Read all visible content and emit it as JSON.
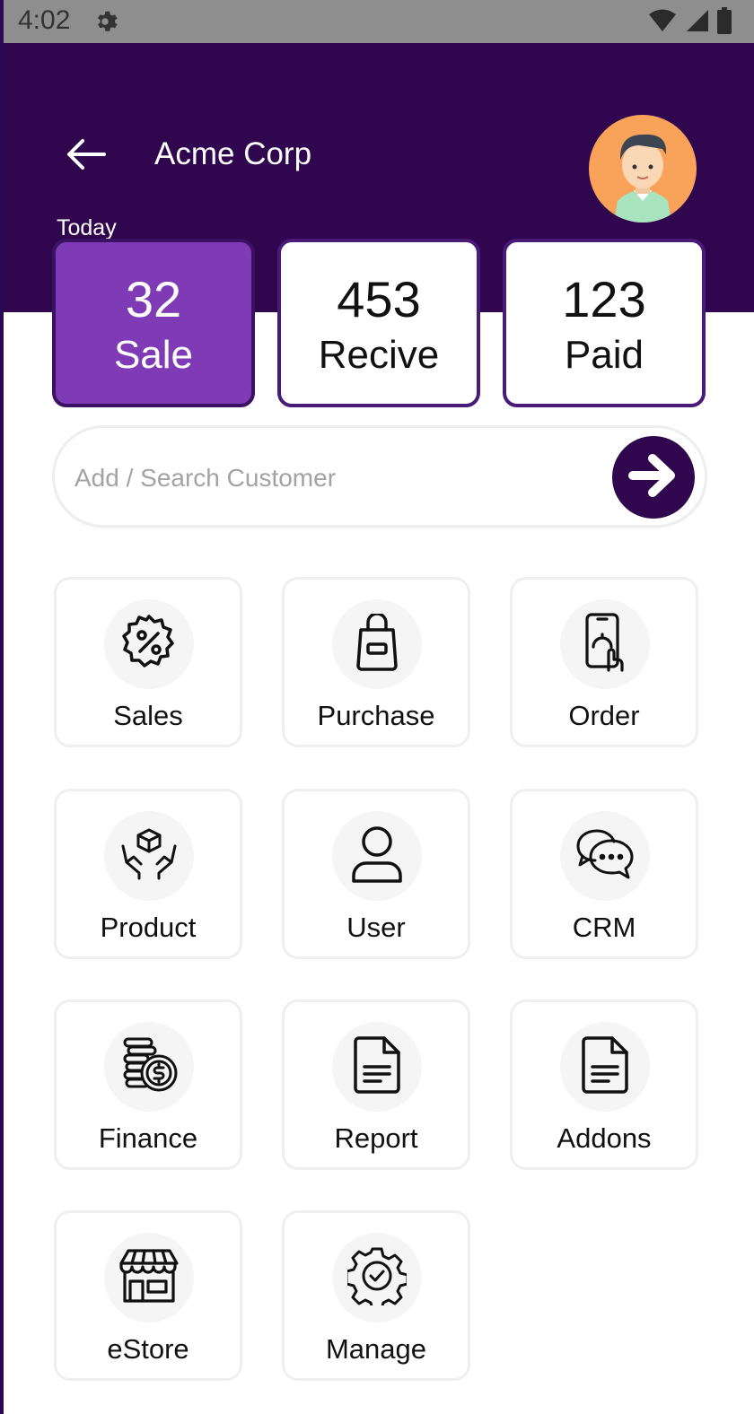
{
  "status_bar": {
    "time": "4:02"
  },
  "header": {
    "company": "Acme Corp",
    "period": "Today"
  },
  "stats": [
    {
      "value": "32",
      "label": "Sale"
    },
    {
      "value": "453",
      "label": "Recive"
    },
    {
      "value": "123",
      "label": "Paid"
    }
  ],
  "search": {
    "placeholder": "Add / Search Customer"
  },
  "tiles": [
    {
      "label": "Sales",
      "icon": "percent-badge-icon"
    },
    {
      "label": "Purchase",
      "icon": "shopping-bag-icon"
    },
    {
      "label": "Order",
      "icon": "mobile-order-icon"
    },
    {
      "label": "Product",
      "icon": "product-hands-icon"
    },
    {
      "label": "User",
      "icon": "user-icon"
    },
    {
      "label": "CRM",
      "icon": "chat-bubbles-icon"
    },
    {
      "label": "Finance",
      "icon": "coins-icon"
    },
    {
      "label": "Report",
      "icon": "document-icon"
    },
    {
      "label": "Addons",
      "icon": "document-icon"
    },
    {
      "label": "eStore",
      "icon": "store-icon"
    },
    {
      "label": "Manage",
      "icon": "gear-check-icon"
    }
  ],
  "colors": {
    "header": "#30074f",
    "accent": "#7f3bb5",
    "border": "#4a1a79"
  }
}
